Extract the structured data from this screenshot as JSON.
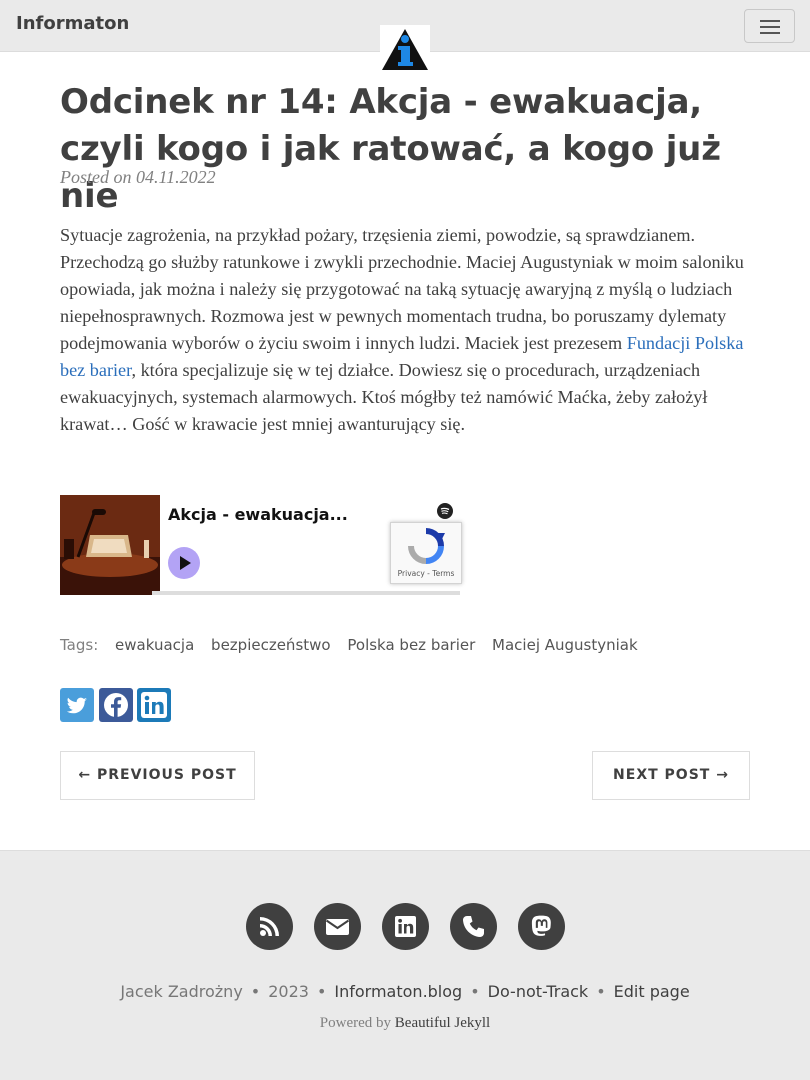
{
  "navbar": {
    "brand": "Informaton",
    "menu_icon": "hamburger-menu-icon",
    "logo_icon": "info-triangle-logo-icon"
  },
  "post": {
    "title": "Odcinek nr 14: Akcja - ewakuacja, czyli kogo i jak ratować, a kogo już nie",
    "posted_on": "Posted on 04.11.2022",
    "body_before_link": "Sytuacje zagrożenia, na przykład pożary, trzęsienia ziemi, powodzie, są sprawdzianem. Przechodzą go służby ratunkowe i zwykli przechodnie. Maciej Augustyniak w moim saloniku opowiada, jak można i należy się przygotować na taką sytuację awaryjną z myślą o ludziach niepełnosprawnych. Rozmowa jest w pewnych momentach trudna, bo poruszamy dylematy podejmowania wyborów o życiu swoim i innych ludzi. Maciek jest prezesem ",
    "link_text": "Fundacji Polska bez barier",
    "body_after_link": ", która specjalizuje się w tej działce. Dowiesz się o procedurach, urządzeniach ewakuacyjnych, systemach alarmowych. Ktoś mógłby też namówić Maćka, żeby założył krawat… Gość w krawacie jest mniej awanturujący się.",
    "link_color": "#2a6ebb"
  },
  "player": {
    "episode_title": "Akcja - ewakuacja...",
    "recaptcha_text": "Privacy - Terms",
    "play_icon": "play-icon",
    "spotify_icon": "spotify-icon"
  },
  "tags": {
    "label": "Tags:",
    "items": [
      "ewakuacja",
      "bezpieczeństwo",
      "Polska bez barier",
      "Maciej Augustyniak"
    ]
  },
  "share": {
    "icons": [
      "twitter-icon",
      "facebook-icon",
      "linkedin-icon"
    ]
  },
  "pager": {
    "previous": "← PREVIOUS POST",
    "next": "NEXT POST →"
  },
  "footer": {
    "icons": [
      "rss-icon",
      "envelope-icon",
      "linkedin-icon",
      "phone-icon",
      "mastodon-icon"
    ],
    "author": "Jacek Zadrożny",
    "year": "2023",
    "site": "Informaton.blog",
    "dnt": "Do-not-Track",
    "edit": "Edit page",
    "powered_prefix": "Powered by ",
    "powered_link": "Beautiful Jekyll",
    "bullet": "•"
  },
  "colors": {
    "navbar_bg": "#eaeaea",
    "footer_bg": "#eaeaea",
    "text": "#404040",
    "twitter": "#4a9edb",
    "facebook": "#3c5a99",
    "linkedin": "#1c7ab8"
  }
}
